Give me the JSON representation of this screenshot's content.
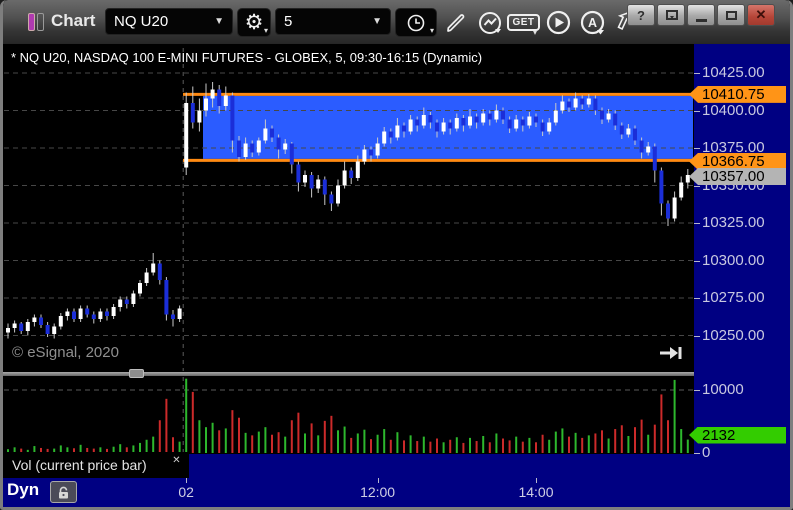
{
  "titlebar": {
    "title": "Chart",
    "symbol": "NQ U20",
    "interval": "5",
    "get_label": "GET",
    "a_label": "A",
    "help_label": "?",
    "close_label": "✕"
  },
  "chart": {
    "title": "* NQ U20, NASDAQ 100 E-MINI FUTURES - GLOBEX, 5, 09:30-16:15 (Dynamic)",
    "watermark": "© eSignal, 2020",
    "price_axis_labels": [
      "10425.00",
      "10400.00",
      "10375.00",
      "10350.00",
      "10325.00",
      "10300.00",
      "10275.00",
      "10250.00"
    ],
    "volume_axis": [
      {
        "label": "10000",
        "value": 10000
      },
      {
        "label": "0",
        "value": 0
      }
    ],
    "badges": [
      {
        "label": "10410.75",
        "type": "zone-top",
        "color": "#ff9417"
      },
      {
        "label": "10366.75",
        "type": "zone-bottom",
        "color": "#ff9417"
      },
      {
        "label": "10357.00",
        "type": "last-price",
        "color": "#b4b4b4"
      },
      {
        "label": "2132",
        "type": "current-volume",
        "color": "#33cc00"
      }
    ]
  },
  "volume_panel": {
    "label": "Vol (current price bar)",
    "close_label": "✕"
  },
  "footer": {
    "mode": "Dyn"
  },
  "colors": {
    "zone_fill": "#2b5cff",
    "zone_border": "#ff8a12",
    "up_candle": "#ffffff",
    "down_candle": "#1b2ed8",
    "wick": "#c9c9c9",
    "vol_up": "#2db82d",
    "vol_down": "#cc2a2a",
    "axis_bg": "#000082",
    "axis_text": "#c8c8e0",
    "gridline": "#474747"
  },
  "chart_data": {
    "type": "candlestick",
    "symbol": "NQ U20",
    "interval_minutes": 5,
    "price_gridlines": [
      10425,
      10400,
      10375,
      10350,
      10325,
      10300,
      10275,
      10250
    ],
    "volume_gridline": 10000,
    "zone": {
      "top": 10410.75,
      "bottom": 10366.75
    },
    "last_price": 10357.0,
    "last_volume": 2132,
    "session_open_index": 27,
    "time_ticks": [
      {
        "label": "02",
        "index": 27
      },
      {
        "label": "12:00",
        "index": 56
      },
      {
        "label": "14:00",
        "index": 80
      }
    ],
    "ohlc": [
      [
        10252,
        10258,
        10248,
        10255
      ],
      [
        10255,
        10260,
        10252,
        10258
      ],
      [
        10258,
        10259,
        10251,
        10253
      ],
      [
        10253,
        10261,
        10250,
        10259
      ],
      [
        10259,
        10264,
        10256,
        10262
      ],
      [
        10262,
        10264,
        10255,
        10257
      ],
      [
        10257,
        10259,
        10249,
        10251
      ],
      [
        10251,
        10258,
        10248,
        10256
      ],
      [
        10256,
        10265,
        10254,
        10263
      ],
      [
        10263,
        10268,
        10260,
        10266
      ],
      [
        10266,
        10268,
        10259,
        10261
      ],
      [
        10261,
        10270,
        10259,
        10268
      ],
      [
        10268,
        10270,
        10262,
        10264
      ],
      [
        10264,
        10266,
        10258,
        10261
      ],
      [
        10261,
        10268,
        10259,
        10266
      ],
      [
        10266,
        10268,
        10260,
        10263
      ],
      [
        10263,
        10271,
        10261,
        10269
      ],
      [
        10269,
        10276,
        10266,
        10274
      ],
      [
        10274,
        10276,
        10268,
        10271
      ],
      [
        10271,
        10280,
        10269,
        10278
      ],
      [
        10278,
        10287,
        10276,
        10285
      ],
      [
        10285,
        10295,
        10283,
        10292
      ],
      [
        10292,
        10305,
        10290,
        10298
      ],
      [
        10298,
        10300,
        10284,
        10287
      ],
      [
        10287,
        10289,
        10260,
        10264
      ],
      [
        10264,
        10267,
        10256,
        10261
      ],
      [
        10261,
        10270,
        10259,
        10268
      ],
      [
        10362,
        10412,
        10357,
        10405
      ],
      [
        10405,
        10416,
        10388,
        10392
      ],
      [
        10392,
        10408,
        10386,
        10400
      ],
      [
        10400,
        10418,
        10396,
        10408
      ],
      [
        10408,
        10419,
        10402,
        10414
      ],
      [
        10414,
        10417,
        10398,
        10403
      ],
      [
        10403,
        10416,
        10400,
        10410
      ],
      [
        10410,
        10412,
        10372,
        10380
      ],
      [
        10380,
        10383,
        10366,
        10369
      ],
      [
        10369,
        10382,
        10367,
        10378
      ],
      [
        10378,
        10380,
        10369,
        10372
      ],
      [
        10372,
        10382,
        10370,
        10380
      ],
      [
        10380,
        10394,
        10378,
        10388
      ],
      [
        10388,
        10390,
        10379,
        10382
      ],
      [
        10382,
        10384,
        10368,
        10374
      ],
      [
        10374,
        10381,
        10371,
        10378
      ],
      [
        10378,
        10379,
        10358,
        10364
      ],
      [
        10364,
        10366,
        10346,
        10352
      ],
      [
        10352,
        10360,
        10349,
        10357
      ],
      [
        10357,
        10359,
        10342,
        10348
      ],
      [
        10348,
        10357,
        10345,
        10354
      ],
      [
        10354,
        10356,
        10337,
        10344
      ],
      [
        10344,
        10346,
        10333,
        10338
      ],
      [
        10338,
        10354,
        10336,
        10350
      ],
      [
        10350,
        10366,
        10348,
        10360
      ],
      [
        10360,
        10362,
        10351,
        10355
      ],
      [
        10355,
        10370,
        10353,
        10366
      ],
      [
        10366,
        10377,
        10364,
        10374
      ],
      [
        10374,
        10376,
        10366,
        10370
      ],
      [
        10370,
        10382,
        10368,
        10378
      ],
      [
        10378,
        10389,
        10376,
        10386
      ],
      [
        10386,
        10388,
        10378,
        10382
      ],
      [
        10382,
        10395,
        10380,
        10390
      ],
      [
        10390,
        10392,
        10382,
        10386
      ],
      [
        10386,
        10397,
        10384,
        10394
      ],
      [
        10394,
        10396,
        10386,
        10390
      ],
      [
        10390,
        10402,
        10388,
        10397
      ],
      [
        10397,
        10399,
        10388,
        10392
      ],
      [
        10392,
        10394,
        10382,
        10386
      ],
      [
        10386,
        10395,
        10384,
        10392
      ],
      [
        10392,
        10394,
        10384,
        10388
      ],
      [
        10388,
        10398,
        10386,
        10395
      ],
      [
        10395,
        10397,
        10386,
        10390
      ],
      [
        10390,
        10401,
        10388,
        10396
      ],
      [
        10396,
        10398,
        10388,
        10392
      ],
      [
        10392,
        10401,
        10390,
        10398
      ],
      [
        10398,
        10400,
        10390,
        10394
      ],
      [
        10394,
        10404,
        10392,
        10400
      ],
      [
        10400,
        10402,
        10391,
        10394
      ],
      [
        10394,
        10396,
        10385,
        10388
      ],
      [
        10388,
        10397,
        10386,
        10394
      ],
      [
        10394,
        10396,
        10386,
        10390
      ],
      [
        10390,
        10399,
        10388,
        10396
      ],
      [
        10396,
        10398,
        10389,
        10392
      ],
      [
        10392,
        10394,
        10383,
        10386
      ],
      [
        10386,
        10395,
        10384,
        10392
      ],
      [
        10392,
        10405,
        10390,
        10400
      ],
      [
        10400,
        10410,
        10398,
        10406
      ],
      [
        10406,
        10408,
        10399,
        10402
      ],
      [
        10402,
        10412,
        10400,
        10408
      ],
      [
        10408,
        10410,
        10401,
        10404
      ],
      [
        10404,
        10411,
        10402,
        10408
      ],
      [
        10408,
        10410,
        10397,
        10400
      ],
      [
        10400,
        10402,
        10391,
        10394
      ],
      [
        10394,
        10401,
        10392,
        10398
      ],
      [
        10398,
        10400,
        10387,
        10390
      ],
      [
        10390,
        10392,
        10381,
        10384
      ],
      [
        10384,
        10391,
        10382,
        10388
      ],
      [
        10388,
        10390,
        10377,
        10380
      ],
      [
        10380,
        10382,
        10368,
        10372
      ],
      [
        10372,
        10379,
        10370,
        10376
      ],
      [
        10376,
        10378,
        10352,
        10360
      ],
      [
        10360,
        10362,
        10330,
        10338
      ],
      [
        10338,
        10340,
        10323,
        10328
      ],
      [
        10328,
        10346,
        10326,
        10342
      ],
      [
        10342,
        10356,
        10340,
        10352
      ],
      [
        10352,
        10361,
        10348,
        10357
      ]
    ],
    "volume": [
      600,
      900,
      700,
      500,
      1100,
      800,
      650,
      700,
      1200,
      900,
      750,
      1300,
      800,
      700,
      900,
      650,
      1000,
      1400,
      900,
      1200,
      1600,
      2100,
      2600,
      5200,
      8600,
      2500,
      1800,
      11800,
      9700,
      5200,
      4100,
      4800,
      3600,
      3900,
      6800,
      5600,
      3200,
      2800,
      3400,
      4100,
      2900,
      3300,
      2600,
      5200,
      6400,
      3100,
      4700,
      2800,
      5100,
      5900,
      3600,
      4200,
      2400,
      3100,
      3700,
      2200,
      2900,
      3800,
      2100,
      3300,
      2000,
      2800,
      1900,
      2600,
      1800,
      2300,
      1700,
      2100,
      2500,
      1600,
      2400,
      1900,
      2700,
      1700,
      3100,
      2300,
      2000,
      2600,
      1800,
      2400,
      1700,
      2900,
      2100,
      3400,
      3900,
      2600,
      3200,
      2400,
      2800,
      3100,
      3600,
      2300,
      3800,
      4400,
      2700,
      4100,
      5300,
      2900,
      4500,
      9300,
      5200,
      11600,
      3800,
      2132
    ]
  }
}
